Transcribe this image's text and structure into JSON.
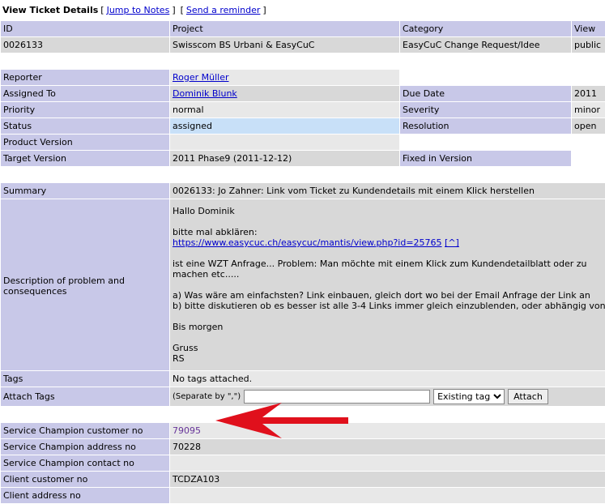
{
  "topbar": {
    "title": "View Ticket Details",
    "jump_to_notes": "Jump to Notes",
    "send_reminder": "Send a reminder",
    "bracket_open": "[",
    "bracket_close": "]"
  },
  "header_row": {
    "id": "ID",
    "project": "Project",
    "category": "Category",
    "view_status": "View"
  },
  "ticket_row": {
    "id": "0026133",
    "project": "Swisscom BS Urbani & EasyCuC",
    "category": "EasyCuC Change Request/Idee",
    "view_status": "public"
  },
  "fields": {
    "reporter_label": "Reporter",
    "reporter_value": "Roger Müller",
    "assigned_label": "Assigned To",
    "assigned_value": "Dominik Blunk",
    "due_label": "Due Date",
    "due_value": "2011",
    "priority_label": "Priority",
    "priority_value": "normal",
    "severity_label": "Severity",
    "severity_value": "minor",
    "status_label": "Status",
    "status_value": "assigned",
    "resolution_label": "Resolution",
    "resolution_value": "open",
    "product_version_label": "Product Version",
    "target_version_label": "Target Version",
    "target_version_value": "2011 Phase9 (2011-12-12)",
    "fixed_in_label": "Fixed in Version"
  },
  "summary": {
    "label": "Summary",
    "value": "0026133: Jo Zahner: Link vom Ticket zu Kundendetails mit einem Klick herstellen"
  },
  "description": {
    "label": "Description of problem and consequences",
    "greeting": "Hallo Dominik",
    "line_check": "bitte mal abklären:",
    "link": "https://www.easycuc.ch/easycuc/mantis/view.php?id=25765",
    "link_suffix": "[^]",
    "line_request_1": "ist eine WZT Anfrage... Problem: Man möchte mit einem Klick zum Kundendetailblatt oder zu",
    "line_request_2": "machen etc.....",
    "line_a": "a) Was wäre am einfachsten? Link einbauen, gleich dort wo bei der Email Anfrage der Link an",
    "line_b": "b) bitte diskutieren ob es besser ist alle 3-4 Links immer gleich einzublenden, oder abhängig von",
    "line_tomorrow": "Bis morgen",
    "line_regards": "Gruss",
    "line_sign": "RS"
  },
  "tags": {
    "label": "Tags",
    "value": "No tags attached."
  },
  "attach_tags": {
    "label": "Attach Tags",
    "hint": "(Separate by \",\")",
    "input_value": "",
    "select_value": "Existing tags",
    "button": "Attach"
  },
  "custom": {
    "sc_customer_no_label": "Service Champion customer no",
    "sc_customer_no_value": "79095",
    "sc_address_no_label": "Service Champion address no",
    "sc_address_no_value": "70228",
    "sc_contact_no_label": "Service Champion contact no",
    "sc_contact_no_value": "",
    "client_customer_no_label": "Client customer no",
    "client_customer_no_value": "TCDZA103",
    "client_last_label": "Client address no"
  },
  "colors": {
    "header_bg": "#c8c8e8",
    "value_bg": "#d8d8d8",
    "highlight_bg": "#c8e0f8",
    "link": "#0000cc",
    "arrow": "#e0101c"
  }
}
